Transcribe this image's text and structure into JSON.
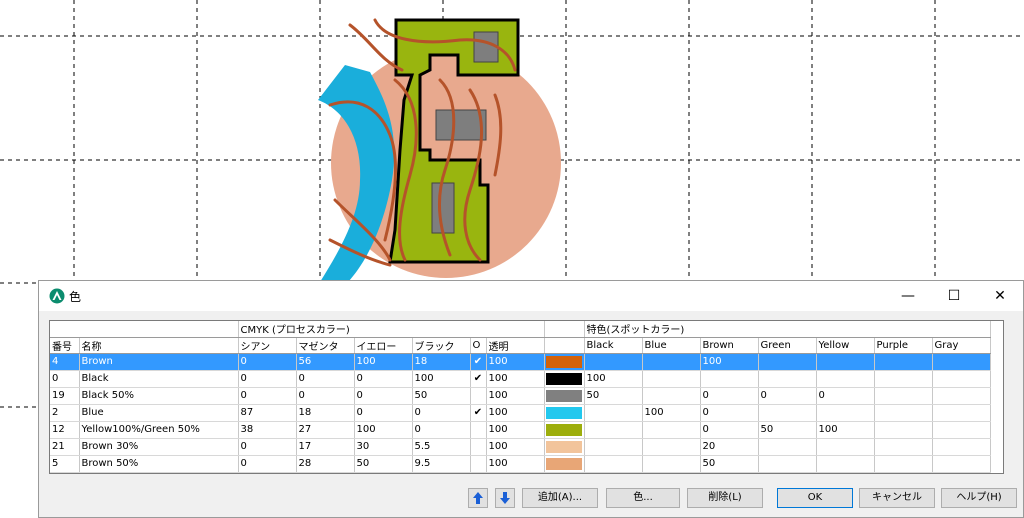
{
  "dialog": {
    "title": "色",
    "window_buttons": {
      "minimize": "—",
      "maximize": "☐",
      "close": "✕"
    }
  },
  "table": {
    "group_headers": {
      "cmyk": "CMYK (プロセスカラー)",
      "spot": "特色(スポットカラー)"
    },
    "columns": {
      "number": "番号",
      "name": "名称",
      "cyan": "シアン",
      "magenta": "マゼンタ",
      "yellow": "イエロー",
      "black": "ブラック",
      "o": "O",
      "opacity": "透明",
      "spot": [
        "Black",
        "Blue",
        "Brown",
        "Green",
        "Yellow",
        "Purple",
        "Gray"
      ]
    },
    "rows": [
      {
        "num": "4",
        "name": "Brown",
        "c": "0",
        "m": "56",
        "y": "100",
        "k": "18",
        "o": "✔",
        "opacity": "100",
        "swatch": "#d4620a",
        "spot": [
          "",
          "",
          "100",
          "",
          "",
          "",
          ""
        ],
        "selected": true
      },
      {
        "num": "0",
        "name": "Black",
        "c": "0",
        "m": "0",
        "y": "0",
        "k": "100",
        "o": "✔",
        "opacity": "100",
        "swatch": "#000000",
        "spot": [
          "100",
          "",
          "",
          "",
          "",
          "",
          ""
        ]
      },
      {
        "num": "19",
        "name": "Black 50%",
        "c": "0",
        "m": "0",
        "y": "0",
        "k": "50",
        "o": "",
        "opacity": "100",
        "swatch": "#808080",
        "spot": [
          "50",
          "",
          "0",
          "0",
          "0",
          "",
          ""
        ]
      },
      {
        "num": "2",
        "name": "Blue",
        "c": "87",
        "m": "18",
        "y": "0",
        "k": "0",
        "o": "✔",
        "opacity": "100",
        "swatch": "#22c8ee",
        "spot": [
          "",
          "100",
          "0",
          "",
          "",
          "",
          ""
        ]
      },
      {
        "num": "12",
        "name": "Yellow100%/Green 50%",
        "c": "38",
        "m": "27",
        "y": "100",
        "k": "0",
        "o": "",
        "opacity": "100",
        "swatch": "#9dae0c",
        "spot": [
          "",
          "",
          "0",
          "50",
          "100",
          "",
          ""
        ]
      },
      {
        "num": "21",
        "name": "Brown 30%",
        "c": "0",
        "m": "17",
        "y": "30",
        "k": "5.5",
        "o": "",
        "opacity": "100",
        "swatch": "#f2c49b",
        "spot": [
          "",
          "",
          "20",
          "",
          "",
          "",
          ""
        ]
      },
      {
        "num": "5",
        "name": "Brown 50%",
        "c": "0",
        "m": "28",
        "y": "50",
        "k": "9.5",
        "o": "",
        "opacity": "100",
        "swatch": "#e8a676",
        "spot": [
          "",
          "",
          "50",
          "",
          "",
          "",
          ""
        ]
      }
    ]
  },
  "buttons": {
    "up": "up-arrow",
    "down": "down-arrow",
    "add": "追加(A)...",
    "color": "色...",
    "delete": "削除(L)",
    "ok": "OK",
    "cancel": "キャンセル",
    "help": "ヘルプ(H)"
  },
  "colors": {
    "selection": "#3399ff",
    "map_brown": "#b5532a",
    "map_blue": "#1aaedb",
    "map_green": "#99b50f",
    "map_circle": "#e8a98e",
    "map_gray": "#7e7e7e"
  }
}
